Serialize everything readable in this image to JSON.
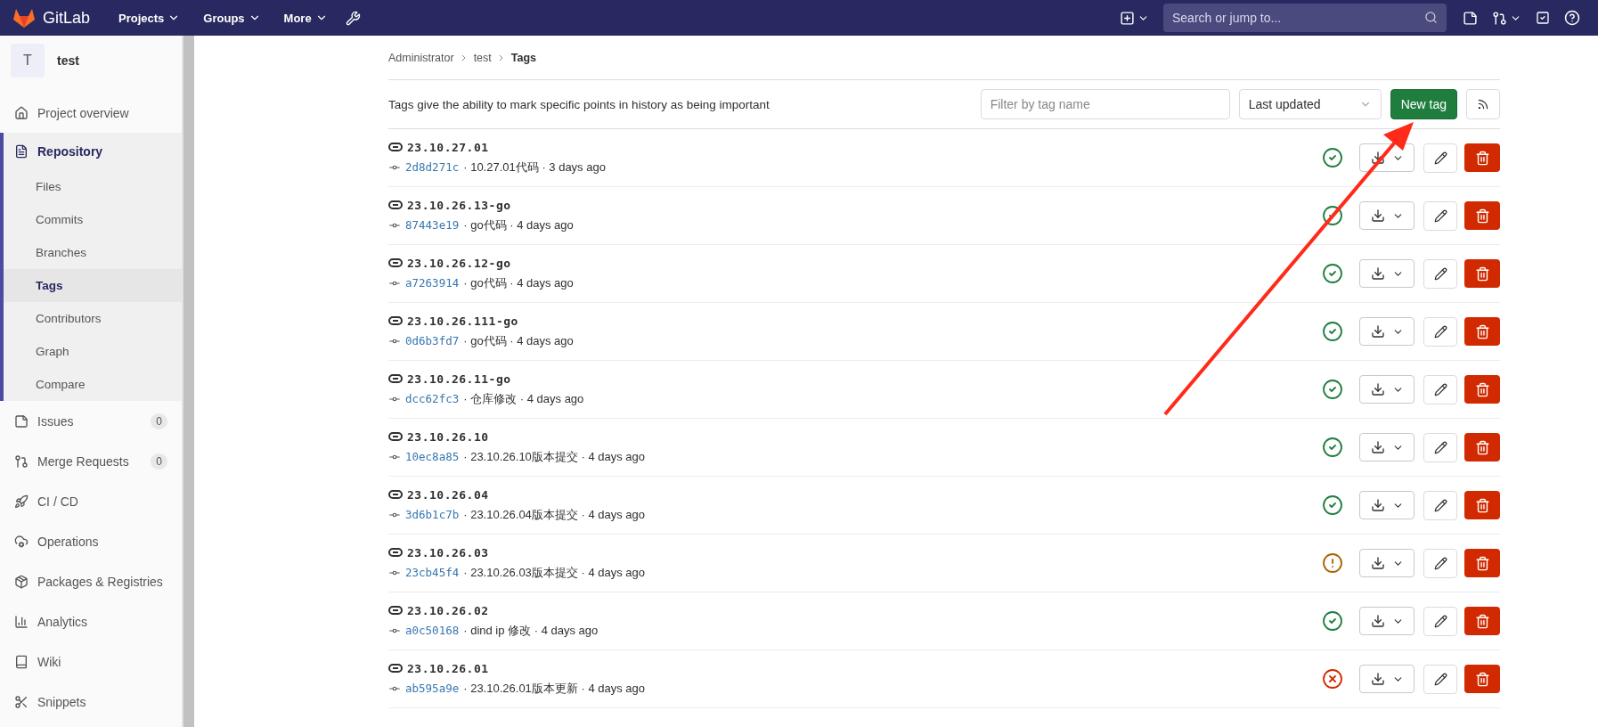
{
  "navbar": {
    "brand": "GitLab",
    "menus": [
      "Projects",
      "Groups",
      "More"
    ],
    "search": {
      "placeholder": "Search or jump to..."
    }
  },
  "sidebar": {
    "project": {
      "avatar": "T",
      "name": "test"
    },
    "items": [
      {
        "label": "Project overview",
        "selected": false
      },
      {
        "label": "Repository",
        "expanded": true,
        "children": [
          {
            "label": "Files",
            "selected": false
          },
          {
            "label": "Commits",
            "selected": false
          },
          {
            "label": "Branches",
            "selected": false
          },
          {
            "label": "Tags",
            "selected": true
          },
          {
            "label": "Contributors",
            "selected": false
          },
          {
            "label": "Graph",
            "selected": false
          },
          {
            "label": "Compare",
            "selected": false
          }
        ]
      },
      {
        "label": "Issues",
        "selected": false,
        "count": "0"
      },
      {
        "label": "Merge Requests",
        "selected": false,
        "count": "0"
      },
      {
        "label": "CI / CD",
        "selected": false
      },
      {
        "label": "Operations",
        "selected": false
      },
      {
        "label": "Packages & Registries",
        "selected": false
      },
      {
        "label": "Analytics",
        "selected": false
      },
      {
        "label": "Wiki",
        "selected": false
      },
      {
        "label": "Snippets",
        "selected": false
      }
    ]
  },
  "breadcrumb": [
    "Administrator",
    "test",
    "Tags"
  ],
  "intro": "Tags give the ability to mark specific points in history as being important",
  "filter": {
    "placeholder": "Filter by tag name"
  },
  "sort": {
    "value": "Last updated"
  },
  "new_tag_button": "New tag",
  "tags": [
    {
      "name": "23.10.27.01",
      "sha": "2d8d271c",
      "summary": "· 10.27.01代码 · 3 days ago",
      "kind": "success"
    },
    {
      "name": "23.10.26.13-go",
      "sha": "87443e19",
      "summary": "· go代码 · 4 days ago",
      "kind": "success"
    },
    {
      "name": "23.10.26.12-go",
      "sha": "a7263914",
      "summary": "· go代码 · 4 days ago",
      "kind": "success"
    },
    {
      "name": "23.10.26.111-go",
      "sha": "0d6b3fd7",
      "summary": "· go代码 · 4 days ago",
      "kind": "success"
    },
    {
      "name": "23.10.26.11-go",
      "sha": "dcc62fc3",
      "summary": "· 仓库修改 · 4 days ago",
      "kind": "success"
    },
    {
      "name": "23.10.26.10",
      "sha": "10ec8a85",
      "summary": "· 23.10.26.10版本提交 · 4 days ago",
      "kind": "success"
    },
    {
      "name": "23.10.26.04",
      "sha": "3d6b1c7b",
      "summary": "· 23.10.26.04版本提交 · 4 days ago",
      "kind": "success"
    },
    {
      "name": "23.10.26.03",
      "sha": "23cb45f4",
      "summary": "· 23.10.26.03版本提交 · 4 days ago",
      "kind": "warning"
    },
    {
      "name": "23.10.26.02",
      "sha": "a0c50168",
      "summary": "· dind ip 修改 · 4 days ago",
      "kind": "success"
    },
    {
      "name": "23.10.26.01",
      "sha": "ab595a9e",
      "summary": "· 23.10.26.01版本更新 · 4 days ago",
      "kind": "failed"
    }
  ]
}
